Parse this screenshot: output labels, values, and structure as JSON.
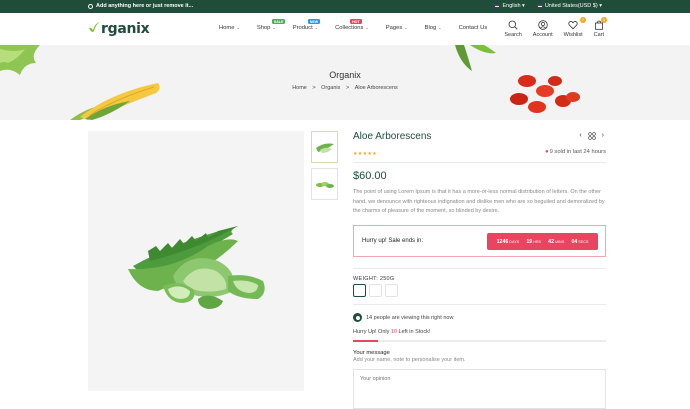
{
  "topbar": {
    "message": "Add anything here or just remove it...",
    "language": "English",
    "currency": "United States(USD $)"
  },
  "header": {
    "logo": "rganix",
    "logo_mark": "✓",
    "nav": [
      {
        "label": "Home",
        "badge": null
      },
      {
        "label": "Shop",
        "badge": "SALE",
        "badge_color": "#4caf50"
      },
      {
        "label": "Product",
        "badge": "NEW",
        "badge_color": "#2196f3"
      },
      {
        "label": "Collections",
        "badge": "HOT",
        "badge_color": "#e94560"
      },
      {
        "label": "Pages",
        "badge": null
      },
      {
        "label": "Blog",
        "badge": null
      },
      {
        "label": "Contact Us",
        "badge": null
      }
    ],
    "icons": {
      "search": "Search",
      "account": "Account",
      "wishlist": "Wishlist",
      "wishlist_count": "0",
      "cart": "Cart",
      "cart_count": "0"
    }
  },
  "banner": {
    "title": "Organix",
    "crumbs": [
      "Home",
      "Organix",
      "Aloe Arborescens"
    ],
    "separator": ">"
  },
  "product": {
    "title": "Aloe Arborescens",
    "rating_stars": 5,
    "rating_value": 0,
    "sold_text": "9 sold in last 24 hours",
    "price": "$60.00",
    "description": "The point of using Lorem Ipsum is that it has a more-or-less normal distribution of letters. On the other hand, we denounce with righteous indignation and dislike men who are so beguiled and demoralized by the charms of pleasure of the moment, so blinded by desire.",
    "sale_label": "Hurry up! Sale ends in:",
    "timer": [
      {
        "value": "1246",
        "unit": "DAYS"
      },
      {
        "value": "19",
        "unit": "HRS"
      },
      {
        "value": "42",
        "unit": "MINS"
      },
      {
        "value": "04",
        "unit": "SECS"
      }
    ],
    "weight_label": "WEIGHT: 250G",
    "viewing_text": "14 people are viewing this right now",
    "stock_prefix": "Hurry Up! Only ",
    "stock_count": "10",
    "stock_suffix": " Left in Stock!",
    "stock_fraction": 0.1,
    "message_title": "Your message",
    "message_subtitle": "Add your name, note to personalise your item.",
    "message_placeholder": "Your opinion"
  },
  "colors": {
    "brand": "#1f4d3a",
    "accent": "#e94560",
    "star": "#f5a623"
  }
}
